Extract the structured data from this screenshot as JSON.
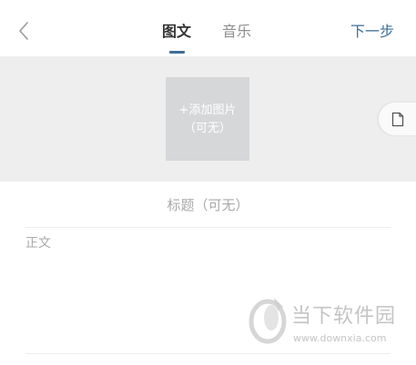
{
  "header": {
    "tabs": [
      {
        "label": "图文",
        "active": true
      },
      {
        "label": "音乐",
        "active": false
      }
    ],
    "next_label": "下一步",
    "accent_color": "#3d6f9a"
  },
  "cover": {
    "add_label": "+添加图片",
    "optional_label": "（可无）"
  },
  "draft_icon": "document-icon",
  "editor": {
    "title_placeholder": "标题（可无）",
    "body_placeholder": "正文"
  },
  "watermark": {
    "name": "当下软件园",
    "url": "www.downxia.com"
  }
}
